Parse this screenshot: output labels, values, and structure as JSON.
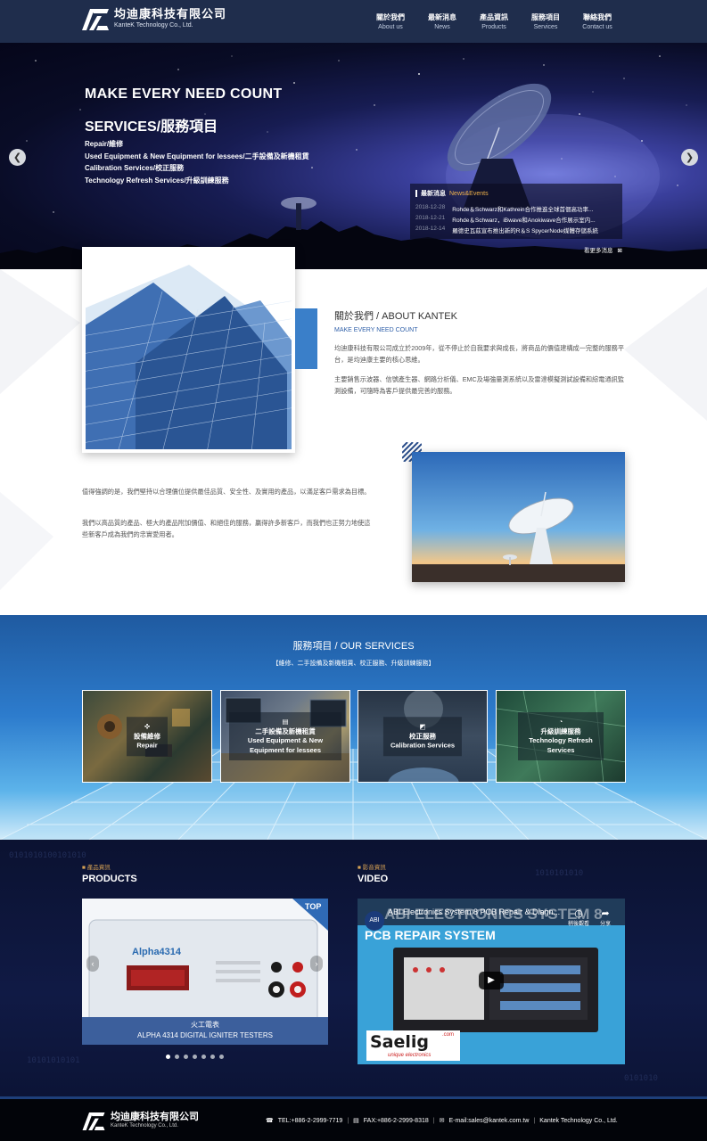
{
  "header": {
    "logo_cn": "均迪康科技有限公司",
    "logo_en": "KanteK Technology Co., Ltd.",
    "nav": [
      {
        "cn": "關於我們",
        "en": "About us"
      },
      {
        "cn": "最新消息",
        "en": "News"
      },
      {
        "cn": "產品資訊",
        "en": "Products"
      },
      {
        "cn": "服務項目",
        "en": "Services"
      },
      {
        "cn": "聯絡我們",
        "en": "Contact us"
      }
    ]
  },
  "hero": {
    "headline": "MAKE EVERY NEED COUNT",
    "title": "SERVICES/服務項目",
    "items": [
      "Repair/維修",
      "Used Equipment & New Equipment for lessees/二手設備及新機租賃",
      "Calibration Services/校正服務",
      "Technology Refresh Services/升級訓練服務"
    ],
    "prev_icon": "chevron-left-icon",
    "next_icon": "chevron-right-icon",
    "news": {
      "title_cn": "最新消息",
      "title_en": "News&Events",
      "rows": [
        {
          "date": "2018-12-28",
          "text": "Rohde＆Schwarz和Kathrein合作推進全球首個高功率..."
        },
        {
          "date": "2018-12-21",
          "text": "Rohde＆Schwarz，iBwave和Anokiwave合作展示室内..."
        },
        {
          "date": "2018-12-14",
          "text": "羅德史瓦茲宣布推出新的R＆S SpycerNode媒體存儲系統"
        }
      ],
      "more": "看更多消息"
    }
  },
  "about": {
    "title": "關於我們 / ABOUT KANTEK",
    "subtitle": "MAKE EVERY NEED COUNT",
    "p1": "均迪康科技有限公司成立於2009年，從不停止於自我要求與成長，將商品的價值建構成一完整的服務平台，是均迪康主要的核心思維。",
    "p2": "主要銷售示波器、信號產生器、網路分析儀、EMC及場強量測系統以及雷達模擬測試設備和綜電通訊監測設備，可隨時為客戶提供最完善的服務。",
    "p3": "值得強調的是，我們堅持以合理價位提供最佳品質、安全性、及實用的產品，以滿足客戶需求為目標。",
    "p4": "我們以高品質的產品、極大的產品附加價值、和絕佳的服務，贏得許多新客戶，而我們也正努力地使這些新客戶成為我們的忠實愛用者。"
  },
  "services": {
    "title": "服務項目 / OUR SERVICES",
    "subtitle": "【維修、二手設備及新機租賃、校正服務、升級訓練服務】",
    "cards": [
      {
        "cn": "設備維修",
        "en": "Repair",
        "icon": "wrench-icon"
      },
      {
        "cn": "二手設備及新機租賃",
        "en": "Used Equipment & New Equipment for lessees",
        "icon": "server-icon"
      },
      {
        "cn": "校正服務",
        "en": "Calibration Services",
        "icon": "calibrate-icon"
      },
      {
        "cn": "升級訓練服務",
        "en": "Technology Refresh Services",
        "icon": "wifi-icon"
      }
    ]
  },
  "products": {
    "label": "產品資訊",
    "title": "PRODUCTS",
    "badge": "TOP",
    "device_name": "Alpha4314",
    "caption_cn": "火工電表",
    "caption_en": "ALPHA 4314 DIGITAL IGNITER TESTERS",
    "slide_count": 7,
    "active_slide": 1
  },
  "video": {
    "label": "影音資訊",
    "title": "VIDEO",
    "video_title": "ABI Electronics System 8 PCB Repair & Diagn...",
    "overlay_big": "ABI ELECTRONICS SYSTEM 8",
    "overlay_sub": "PCB REPAIR SYSTEM",
    "brand": "Saelig",
    "brand_tag": "unique electronics",
    "brand_com": ".com",
    "watch_later": "稍後觀看",
    "share": "分享"
  },
  "footer": {
    "logo_cn": "均迪康科技有限公司",
    "logo_en": "KanteK Technology Co., Ltd.",
    "tel": "TEL:+886-2-2999-7719",
    "fax": "FAX:+886-2-2999-8318",
    "email": "E-mail:sales@kantek.com.tw",
    "company": "Kantek Technology Co., Ltd."
  }
}
